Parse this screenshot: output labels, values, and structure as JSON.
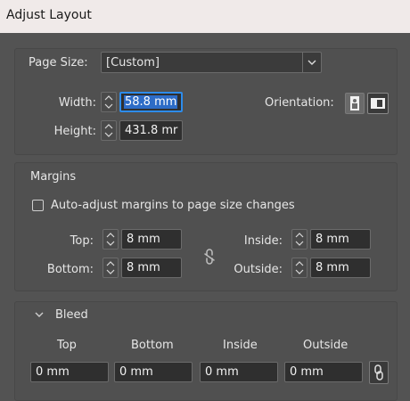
{
  "window": {
    "title": "Adjust Layout"
  },
  "page": {
    "size_label": "Page Size:",
    "size_value": "[Custom]",
    "width_label": "Width:",
    "width_value": "58.8 mm",
    "height_label": "Height:",
    "height_value": "431.8 mr",
    "orientation_label": "Orientation:"
  },
  "margins": {
    "heading": "Margins",
    "auto_adjust_label": "Auto-adjust margins to page size changes",
    "auto_adjust_checked": false,
    "top_label": "Top:",
    "top_value": "8 mm",
    "bottom_label": "Bottom:",
    "bottom_value": "8 mm",
    "inside_label": "Inside:",
    "inside_value": "8 mm",
    "outside_label": "Outside:",
    "outside_value": "8 mm"
  },
  "bleed": {
    "heading": "Bleed",
    "columns": [
      "Top",
      "Bottom",
      "Inside",
      "Outside"
    ],
    "values": [
      "0 mm",
      "0 mm",
      "0 mm",
      "0 mm"
    ]
  },
  "colors": {
    "dialog_bg": "#535353",
    "field_bg": "#2f2f2f",
    "accent": "#2d8ceb"
  }
}
